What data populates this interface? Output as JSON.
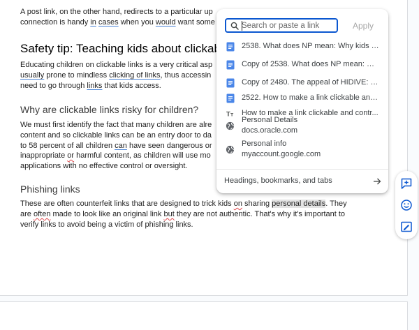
{
  "document": {
    "intro_line1_a": "A post link, on the other hand, redirects to a particular up",
    "intro_line2_a": "connection is handy ",
    "intro_line2_in": "in",
    "intro_line2_sp1": " ",
    "intro_line2_cases": "cases",
    "intro_line2_b": " when you ",
    "intro_line2_would": "would",
    "intro_line2_c": " want some",
    "heading_safety": "Safety tip: Teaching kids about clickabl",
    "safety_line1": "Educating children on clickable links is a very critical asp",
    "safety_line2_usually": "usually",
    "safety_line2_a": " prone to mindless ",
    "safety_line2_clicking": "clicking of links",
    "safety_line2_b": ", thus accessin",
    "safety_line3_a": "need to go through ",
    "safety_line3_links": "links",
    "safety_line3_b": " that kids access.",
    "heading_risky": "Why are clickable links risky for children?",
    "risky_line1": "We must first identify the fact that many children are alre",
    "risky_line2": "content and so clickable links can be an entry door to da",
    "risky_line3_a": "to 58 percent of all children ",
    "risky_line3_can": "can",
    "risky_line3_b": " have seen dangerous or",
    "risky_line4_a": "inappropriate ",
    "risky_line4_or": "or",
    "risky_line4_b": " harmful content, as children will use mo",
    "risky_line5": "applications with no effective control or oversight.",
    "heading_phishing": "Phishing links",
    "phishing_line1_a": "These are often counterfeit links that are designed to trick kids ",
    "phishing_line1_on": "on",
    "phishing_line1_b": " sharing ",
    "phishing_line1_hl": "personal details",
    "phishing_line1_c": ". They",
    "phishing_line2_a": "are ",
    "phishing_line2_often": "often",
    "phishing_line2_b": " made to look like an original link ",
    "phishing_line2_but": "but",
    "phishing_line2_c": " they are not authentic. That's why it's important to",
    "phishing_line3": "verify links to avoid being a victim of phishing links."
  },
  "link_popup": {
    "search_placeholder": "Search or paste a link",
    "search_value": "",
    "apply_label": "Apply",
    "suggestions": [
      {
        "icon": "google-doc-icon",
        "label": "2538. What does NP mean: Why kids us..."
      },
      {
        "icon": "google-doc-icon",
        "label": "Copy of 2538. What does NP mean: Wh..."
      },
      {
        "icon": "google-doc-icon",
        "label": "Copy of 2480. The appeal of HIDIVE: W..."
      },
      {
        "icon": "google-doc-icon",
        "label": "2522. How to make a link clickable and ..."
      },
      {
        "icon": "heading-text-icon",
        "label": "How to make a link clickable and contr..."
      }
    ],
    "web_results": [
      {
        "icon": "globe-icon",
        "title": "Personal Details",
        "url": "docs.oracle.com"
      },
      {
        "icon": "globe-icon",
        "title": "Personal info",
        "url": "myaccount.google.com"
      }
    ],
    "footer_label": "Headings, bookmarks, and tabs"
  },
  "side_toolbar": {
    "buttons": [
      "add-comment-icon",
      "emoji-reaction-icon",
      "suggest-edits-icon"
    ]
  },
  "colors": {
    "accent": "#0b57d0",
    "doc_icon": "#4a86e8",
    "spell_error": "#e0484c",
    "grammar": "#4b84d6"
  }
}
